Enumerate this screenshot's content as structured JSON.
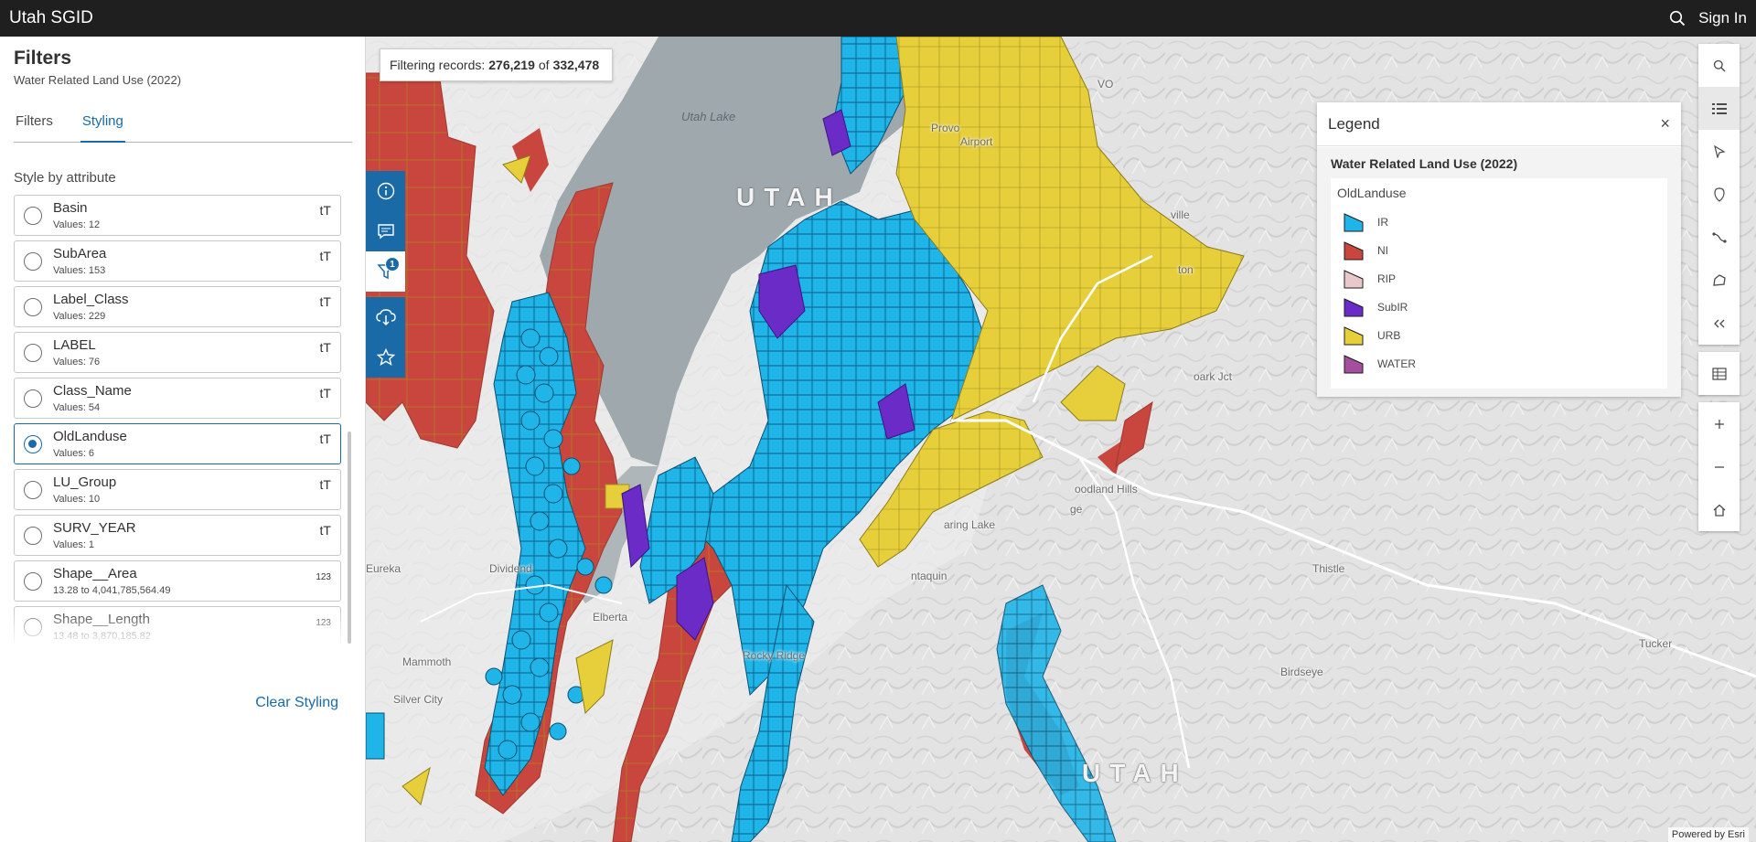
{
  "header": {
    "title": "Utah SGID",
    "sign_in": "Sign In"
  },
  "panel": {
    "title": "Filters",
    "subtitle": "Water Related Land Use (2022)",
    "tabs": [
      {
        "label": "Filters"
      },
      {
        "label": "Styling",
        "active": true
      }
    ],
    "section_label": "Style by attribute",
    "attributes": [
      {
        "name": "Basin",
        "values": "Values: 12",
        "type": "tT"
      },
      {
        "name": "SubArea",
        "values": "Values: 153",
        "type": "tT"
      },
      {
        "name": "Label_Class",
        "values": "Values: 229",
        "type": "tT"
      },
      {
        "name": "LABEL",
        "values": "Values: 76",
        "type": "tT"
      },
      {
        "name": "Class_Name",
        "values": "Values: 54",
        "type": "tT"
      },
      {
        "name": "OldLanduse",
        "values": "Values: 6",
        "type": "tT",
        "selected": true
      },
      {
        "name": "LU_Group",
        "values": "Values: 10",
        "type": "tT"
      },
      {
        "name": "SURV_YEAR",
        "values": "Values: 1",
        "type": "tT"
      },
      {
        "name": "Shape__Area",
        "values": "13.28 to 4,041,785,564.49",
        "type": "123"
      },
      {
        "name": "Shape__Length",
        "values": "13.48 to 3,870,185.82",
        "type": "123"
      }
    ],
    "clear_styling": "Clear Styling"
  },
  "map": {
    "filter": {
      "prefix": "Filtering records:",
      "count": "276,219",
      "of": "of",
      "total": "332,478"
    },
    "filter_badge": "1",
    "labels": [
      {
        "text": "Utah Lake",
        "kind": "lake"
      },
      {
        "text": "UTAH",
        "kind": "big"
      },
      {
        "text": "UTAH",
        "kind": "big"
      },
      {
        "text": "Provo",
        "kind": "small"
      },
      {
        "text": "Airport",
        "kind": "small"
      },
      {
        "text": "VO",
        "kind": "small"
      },
      {
        "text": "ville",
        "kind": "small"
      },
      {
        "text": "ton",
        "kind": "small"
      },
      {
        "text": "oark Jct",
        "kind": "small"
      },
      {
        "text": "oodland Hills",
        "kind": "small"
      },
      {
        "text": "ge",
        "kind": "small"
      },
      {
        "text": "aring Lake",
        "kind": "small"
      },
      {
        "text": "ntaquin",
        "kind": "small"
      },
      {
        "text": "Thistle",
        "kind": "small"
      },
      {
        "text": "Eureka",
        "kind": "small"
      },
      {
        "text": "Dividend",
        "kind": "small"
      },
      {
        "text": "Elberta",
        "kind": "small"
      },
      {
        "text": "Rocky Ridge",
        "kind": "small"
      },
      {
        "text": "Mammoth",
        "kind": "small"
      },
      {
        "text": "Silver City",
        "kind": "small"
      },
      {
        "text": "Birdseye",
        "kind": "small"
      },
      {
        "text": "Tucker",
        "kind": "small"
      }
    ],
    "powered_by": "Powered by Esri"
  },
  "legend": {
    "title": "Legend",
    "close": "×",
    "layer": "Water Related Land Use (2022)",
    "field": "OldLanduse",
    "items": [
      {
        "label": "IR",
        "color": "#1fb5e8"
      },
      {
        "label": "NI",
        "color": "#c8463d"
      },
      {
        "label": "RIP",
        "color": "#e8c8c9"
      },
      {
        "label": "SubIR",
        "color": "#6a2bc7"
      },
      {
        "label": "URB",
        "color": "#e6cf3b"
      },
      {
        "label": "WATER",
        "color": "#a64e9e"
      }
    ]
  },
  "colors": {
    "accent": "#1a6aa8",
    "header_bg": "#1f1f1f",
    "lake": "#9fa9ad",
    "ir": "#1fb5e8",
    "ni": "#c8463d",
    "urb": "#e6cf3b",
    "subir": "#6a2bc7"
  },
  "icons": {
    "side_tools": [
      "info-icon",
      "comment-icon",
      "filter-icon",
      "download-icon",
      "star-icon"
    ],
    "right_tools": [
      "search-icon",
      "legend-icon",
      "select-icon",
      "measure-icon",
      "routing-icon",
      "sketch-icon",
      "collapse-icon",
      "table-icon",
      "zoom-in-icon",
      "zoom-out-icon",
      "home-icon"
    ]
  }
}
